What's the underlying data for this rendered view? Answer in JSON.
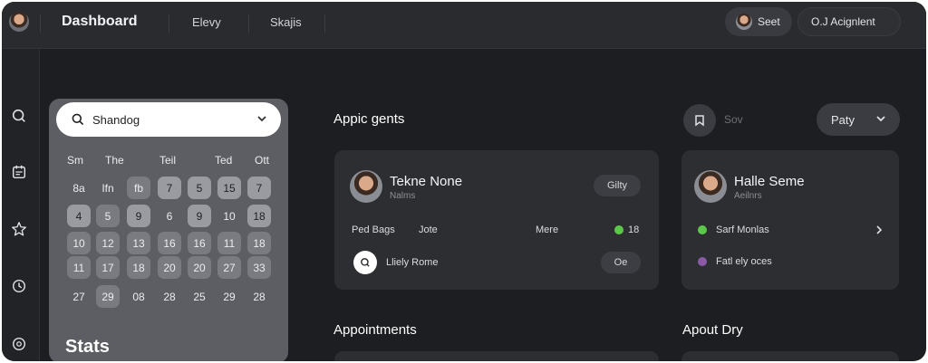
{
  "header": {
    "title": "Dashboard",
    "nav": [
      "Elevy",
      "Skajis"
    ],
    "user_label": "Seet",
    "assign_label": "O.J Acignlent"
  },
  "rail": {
    "icons": [
      "search-icon",
      "calendar-icon",
      "star-icon",
      "clock-icon",
      "settings-icon"
    ]
  },
  "calendar": {
    "search_value": "Shandog",
    "weekdays": [
      "Sm",
      "The",
      "Teil",
      "Ted",
      "Ott"
    ],
    "rows": [
      [
        "8a",
        "Ifn",
        "fb",
        "7",
        "5",
        "15",
        "7"
      ],
      [
        "4",
        "5",
        "9",
        "6",
        "9",
        "10",
        "18"
      ],
      [
        "10",
        "12",
        "13",
        "16",
        "16",
        "11",
        "18"
      ],
      [
        "11",
        "17",
        "18",
        "20",
        "20",
        "27",
        "33"
      ],
      [
        "27",
        "29",
        "08",
        "28",
        "25",
        "29",
        "28"
      ]
    ]
  },
  "stats": {
    "title": "Stats"
  },
  "appointments_top": {
    "title": "Appic gents",
    "sov_label": "Sov",
    "party_label": "Paty",
    "card1": {
      "name": "Tekne None",
      "sub": "Nalms",
      "chip": "Gilty",
      "row1_a": "Ped Bags",
      "row1_b": "Jote",
      "row1_c": "Mere",
      "row1_d": "18",
      "row2_label": "Lliely Rome",
      "row2_chip": "Oe"
    },
    "card2": {
      "name": "Halle Seme",
      "sub": "Aeilnrs",
      "row1": "Sarf Monlas",
      "row2": "Fatl ely oces"
    }
  },
  "appointments": {
    "title": "Appointments"
  },
  "about": {
    "title": "Apout Dry"
  },
  "colors": {
    "background": "#1d1e21",
    "panel": "#5d5e63",
    "card": "#2d2e32",
    "green": "#5cc84a",
    "purple": "#8a5aa8"
  }
}
